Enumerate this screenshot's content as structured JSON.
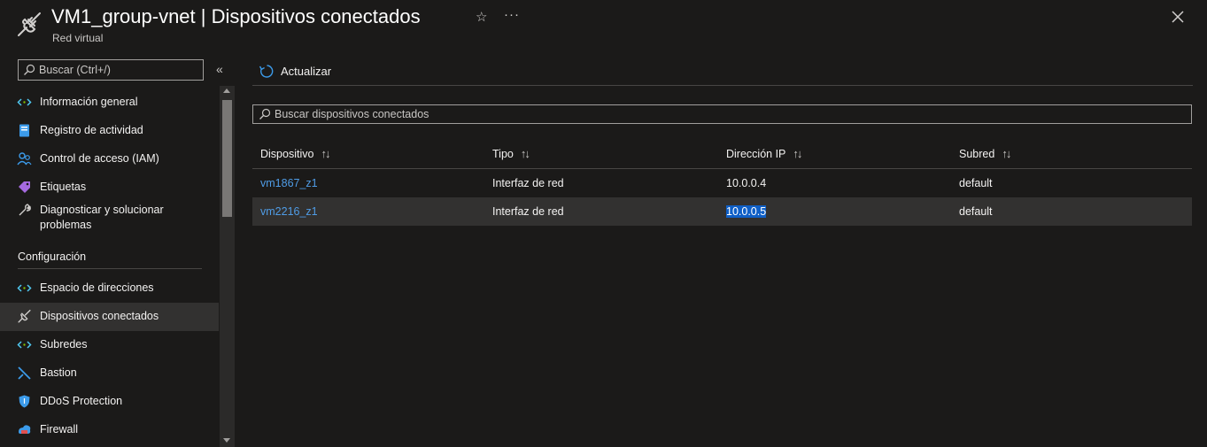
{
  "header": {
    "title": "VM1_group-vnet | Dispositivos conectados",
    "subtitle": "Red virtual",
    "icons": {
      "resource": "connected-devices-icon",
      "favorite": "star-icon",
      "more": "ellipsis-icon",
      "close": "close-icon"
    }
  },
  "sidebar": {
    "search_placeholder": "Buscar (Ctrl+/)",
    "collapse_glyph": "«",
    "items": [
      {
        "label": "Información general",
        "icon": "overview-icon"
      },
      {
        "label": "Registro de actividad",
        "icon": "activity-log-icon"
      },
      {
        "label": "Control de acceso (IAM)",
        "icon": "iam-icon"
      },
      {
        "label": "Etiquetas",
        "icon": "tag-icon"
      },
      {
        "label": "Diagnosticar y solucionar problemas",
        "icon": "wrench-icon"
      }
    ],
    "section_title": "Configuración",
    "config_items": [
      {
        "label": "Espacio de direcciones",
        "icon": "address-space-icon"
      },
      {
        "label": "Dispositivos conectados",
        "icon": "connected-devices-icon",
        "active": true
      },
      {
        "label": "Subredes",
        "icon": "subnets-icon"
      },
      {
        "label": "Bastion",
        "icon": "bastion-icon"
      },
      {
        "label": "DDoS Protection",
        "icon": "shield-icon"
      },
      {
        "label": "Firewall",
        "icon": "firewall-icon"
      }
    ]
  },
  "toolbar": {
    "refresh_label": "Actualizar"
  },
  "main_search": {
    "placeholder": "Buscar dispositivos conectados"
  },
  "table": {
    "columns": [
      "Dispositivo",
      "Tipo",
      "Dirección IP",
      "Subred"
    ],
    "sort_glyph": "↑↓",
    "rows": [
      {
        "device": "vm1867_z1",
        "type": "Interfaz de red",
        "ip": "10.0.0.4",
        "subnet": "default"
      },
      {
        "device": "vm2216_z1",
        "type": "Interfaz de red",
        "ip": "10.0.0.5",
        "subnet": "default"
      }
    ]
  },
  "colors": {
    "background": "#1b1a19",
    "link": "#4f9ce6",
    "selection": "#0f5fc6",
    "active_row": "#323130"
  }
}
